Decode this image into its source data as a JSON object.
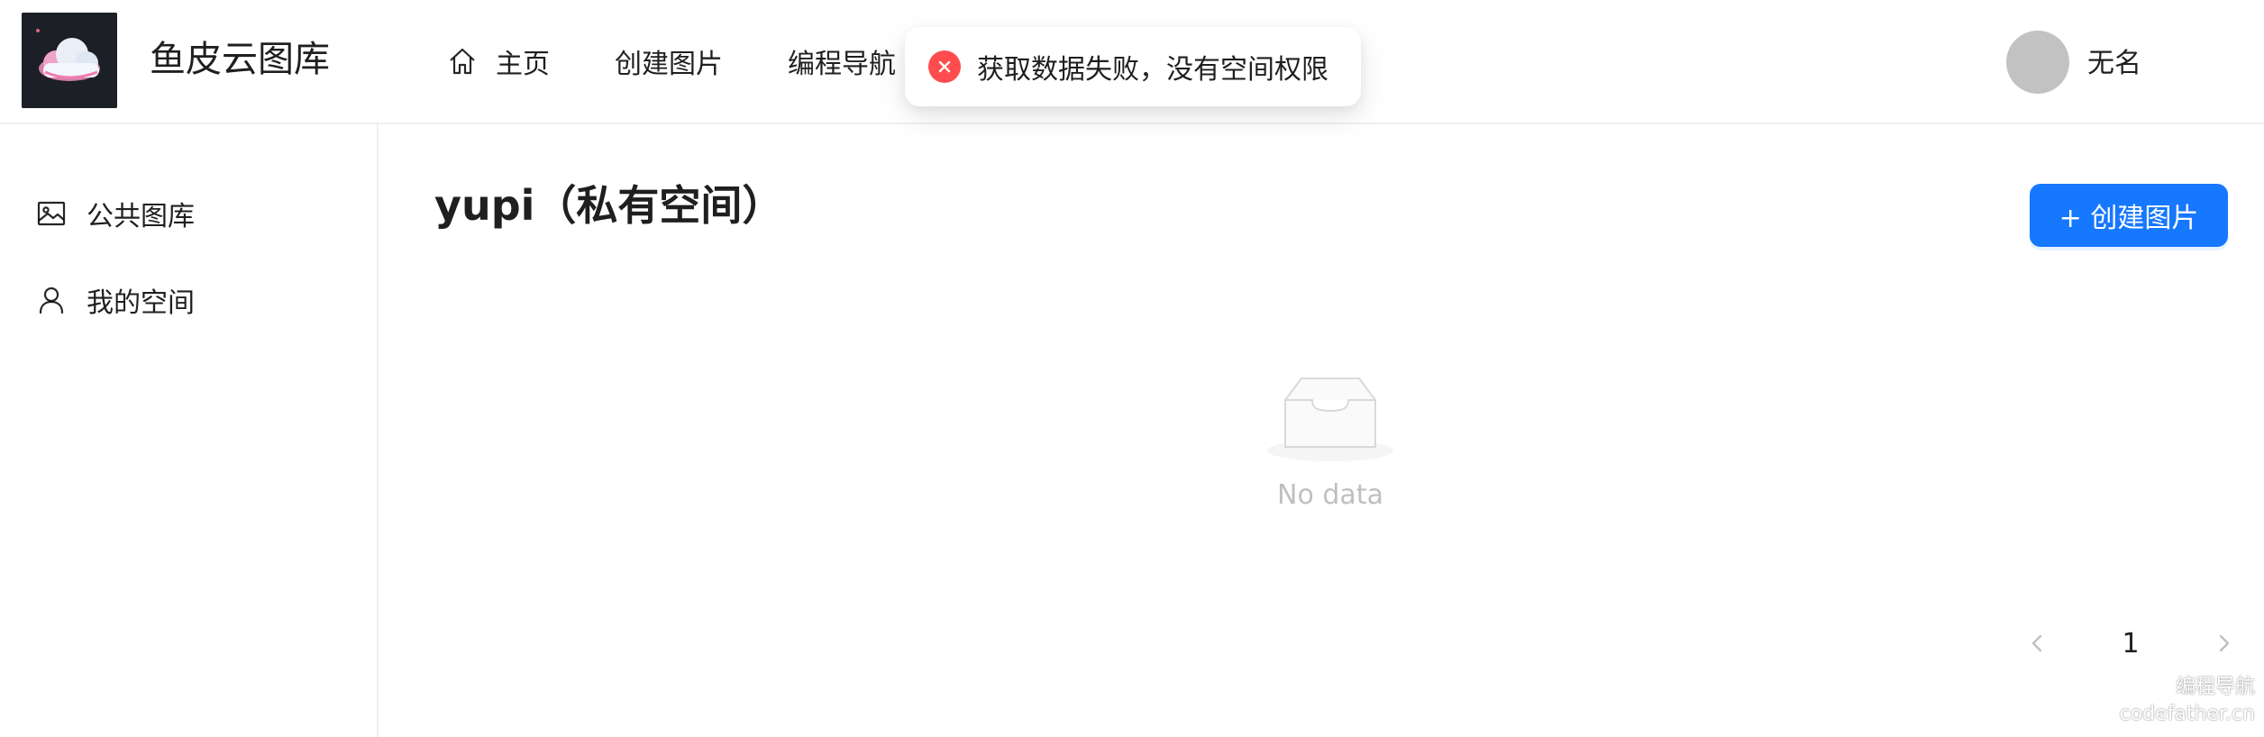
{
  "header": {
    "brand": "鱼皮云图库",
    "nav": [
      {
        "label": "主页",
        "icon": "home-icon"
      },
      {
        "label": "创建图片"
      },
      {
        "label": "编程导航"
      }
    ],
    "user": {
      "name": "无名"
    }
  },
  "toast": {
    "type": "error",
    "icon": "close-circle-icon",
    "message": "获取数据失败，没有空间权限"
  },
  "sidebar": {
    "items": [
      {
        "label": "公共图库",
        "icon": "picture-icon"
      },
      {
        "label": "我的空间",
        "icon": "user-icon"
      }
    ]
  },
  "main": {
    "title": "yupi（私有空间）",
    "create_button": "+ 创建图片",
    "empty_text": "No data"
  },
  "pagination": {
    "current_page": "1"
  },
  "watermark": {
    "line1": "编程导航",
    "line2": "codefather.cn"
  },
  "colors": {
    "primary": "#1677ff",
    "error": "#ff4d4f",
    "avatar": "#c2c2c2"
  }
}
